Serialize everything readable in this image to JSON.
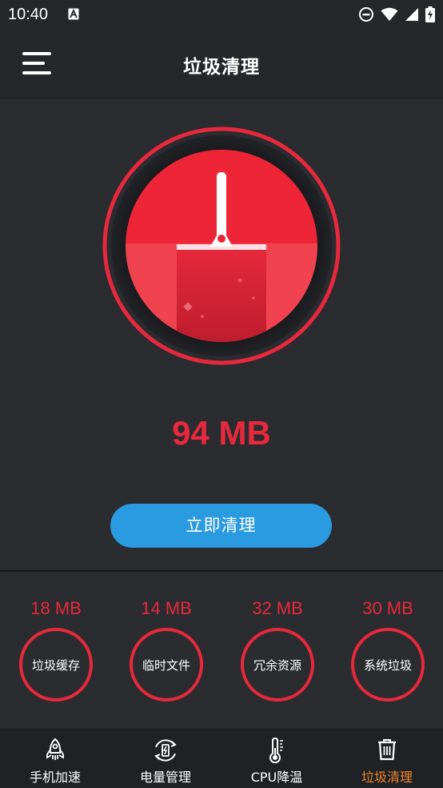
{
  "status": {
    "time": "10:40"
  },
  "header": {
    "title": "垃圾清理"
  },
  "hero": {
    "junk_size": "94 MB",
    "clean_button": "立即清理"
  },
  "categories": [
    {
      "size": "18 MB",
      "label": "垃圾缓存"
    },
    {
      "size": "14 MB",
      "label": "临时文件"
    },
    {
      "size": "32 MB",
      "label": "冗余资源"
    },
    {
      "size": "30 MB",
      "label": "系统垃圾"
    }
  ],
  "tabs": [
    {
      "label": "手机加速",
      "icon": "rocket-icon"
    },
    {
      "label": "电量管理",
      "icon": "battery-cycle-icon"
    },
    {
      "label": "CPU降温",
      "icon": "thermometer-icon"
    },
    {
      "label": "垃圾清理",
      "icon": "trash-icon",
      "active": true
    }
  ],
  "colors": {
    "accent_red": "#e8293d",
    "button_blue": "#2a9ae1",
    "active_tab": "#f1862b",
    "background": "#2b2c30"
  }
}
